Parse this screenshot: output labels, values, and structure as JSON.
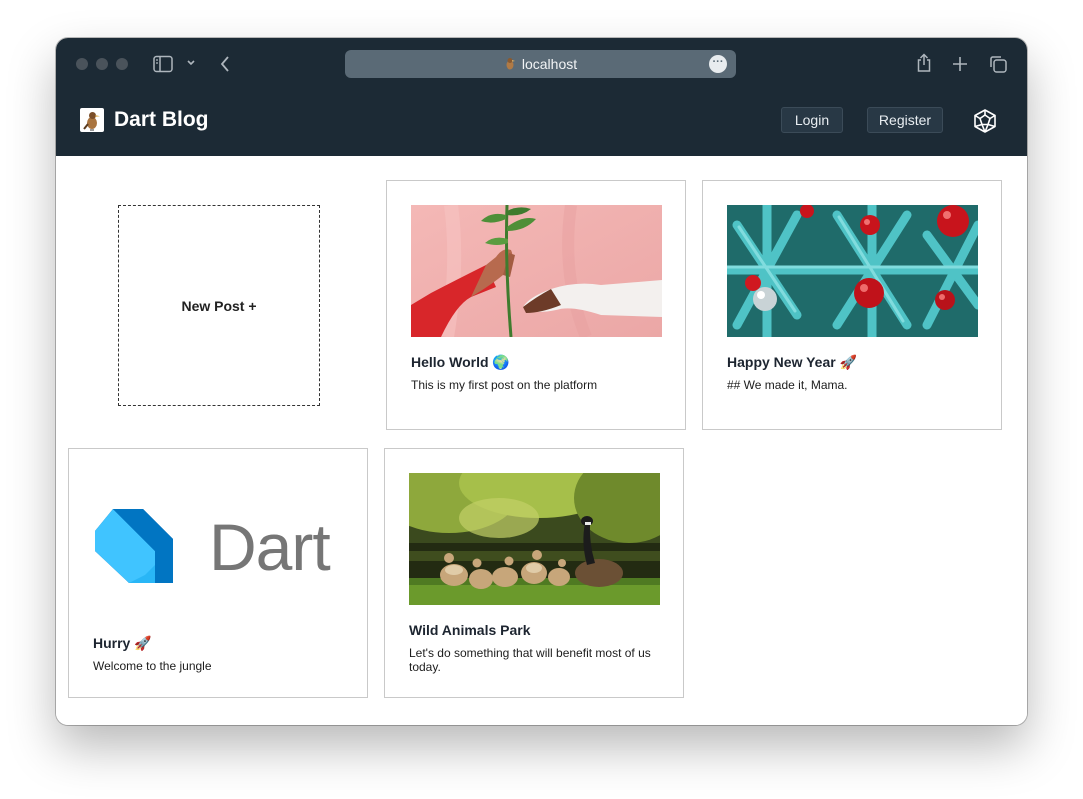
{
  "browser": {
    "url": "localhost",
    "more_icon": "ellipsis-icon"
  },
  "navbar": {
    "brand_title": "Dart Blog",
    "login_label": "Login",
    "register_label": "Register",
    "theme_icon": "polyhedron-icon"
  },
  "new_post": {
    "label": "New Post +"
  },
  "posts": [
    {
      "title": "Hello World",
      "emoji": "🌍",
      "description": "This is my first post on the platform",
      "image": "hands-holding-plant"
    },
    {
      "title": "Happy New Year",
      "emoji": "🚀",
      "description": "## We made it, Mama.",
      "image": "christmas-ornaments"
    },
    {
      "title": "Hurry",
      "emoji": "🚀",
      "description": "Welcome to the jungle",
      "image": "dart-logo",
      "image_text": "Dart"
    },
    {
      "title": "Wild Animals Park",
      "emoji": "",
      "description": "Let's do something that will benefit most of us today.",
      "image": "geese-by-pond"
    }
  ],
  "colors": {
    "navbar_bg": "#1c2a35",
    "dart_blue_light": "#40c4ff",
    "dart_blue_dark": "#01579b"
  }
}
